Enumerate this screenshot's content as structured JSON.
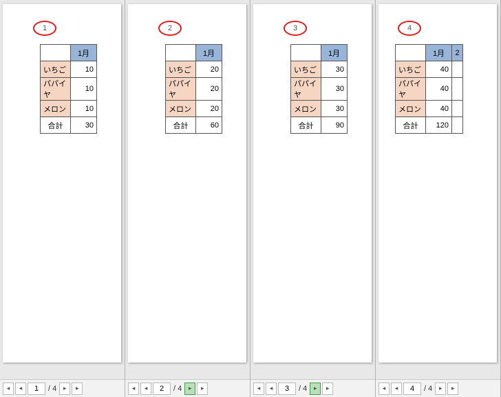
{
  "month_header": "1月",
  "month_header2": "2",
  "row_labels": [
    "いちご",
    "パパイヤ",
    "メロン"
  ],
  "total_label": "合計",
  "panels": [
    {
      "page_num": "1",
      "nav_current": "1",
      "nav_total": "/ 4",
      "values": [
        "10",
        "10",
        "10"
      ],
      "total": "30",
      "next_active": false
    },
    {
      "page_num": "2",
      "nav_current": "2",
      "nav_total": "/ 4",
      "values": [
        "20",
        "20",
        "20"
      ],
      "total": "60",
      "next_active": true
    },
    {
      "page_num": "3",
      "nav_current": "3",
      "nav_total": "/ 4",
      "values": [
        "30",
        "30",
        "30"
      ],
      "total": "90",
      "next_active": true
    },
    {
      "page_num": "4",
      "nav_current": "4",
      "nav_total": "/ 4",
      "values": [
        "40",
        "40",
        "40"
      ],
      "total": "120",
      "next_active": false,
      "has_second_month": true
    }
  ],
  "nav_glyphs": {
    "first": "▮◀",
    "prev": "◀",
    "next": "▶",
    "last": "▶▮"
  }
}
